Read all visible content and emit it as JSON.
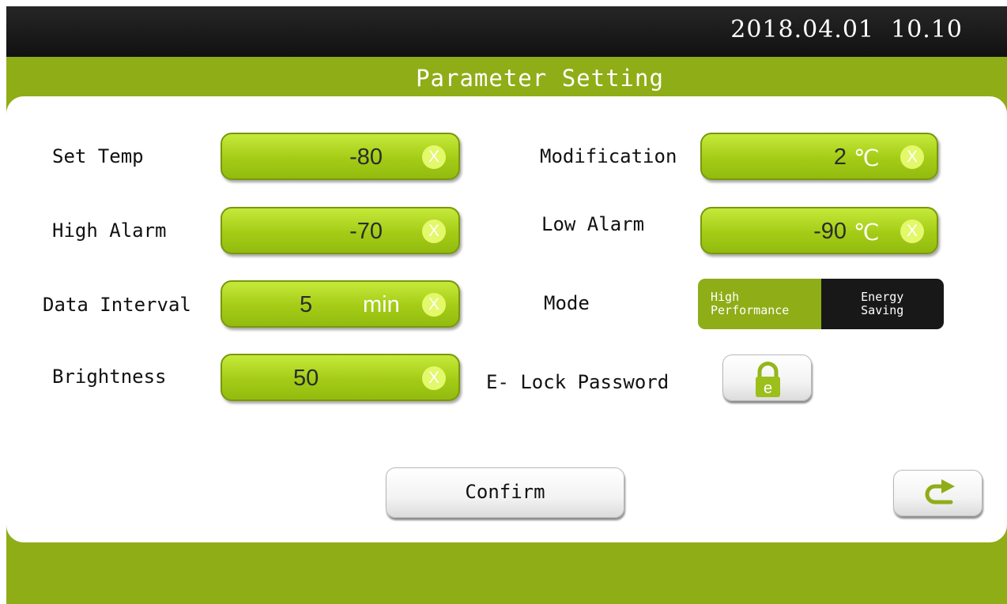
{
  "header": {
    "datetime": "2018.04.01  10.10",
    "title": "Parameter Setting"
  },
  "fields": {
    "set_temp": {
      "label": "Set Temp",
      "value": "-80",
      "clear": "X"
    },
    "high_alarm": {
      "label": "High Alarm",
      "value": "-70",
      "clear": "X"
    },
    "data_interval": {
      "label": "Data Interval",
      "value": "5",
      "unit": "min",
      "clear": "X"
    },
    "brightness": {
      "label": "Brightness",
      "value": "50",
      "clear": "X"
    },
    "modification": {
      "label": "Modification",
      "value": "2",
      "unit": "℃",
      "clear": "X"
    },
    "low_alarm": {
      "label": "Low Alarm",
      "value": "-90",
      "unit": "℃",
      "clear": "X"
    }
  },
  "mode": {
    "label": "Mode",
    "options": [
      {
        "line1": "High",
        "line2": "Performance",
        "selected": true
      },
      {
        "line1": "Energy",
        "line2": "Saving",
        "selected": false
      }
    ]
  },
  "elock": {
    "label": "E- Lock Password",
    "icon": "lock-icon",
    "icon_letter": "e"
  },
  "actions": {
    "confirm_label": "Confirm",
    "back_icon": "return-arrow-icon"
  },
  "colors": {
    "accent_green": "#8fad17",
    "field_green": "#a4cc16",
    "topbar": "#1a1a1a",
    "clear_badge": "#e3f86a"
  }
}
